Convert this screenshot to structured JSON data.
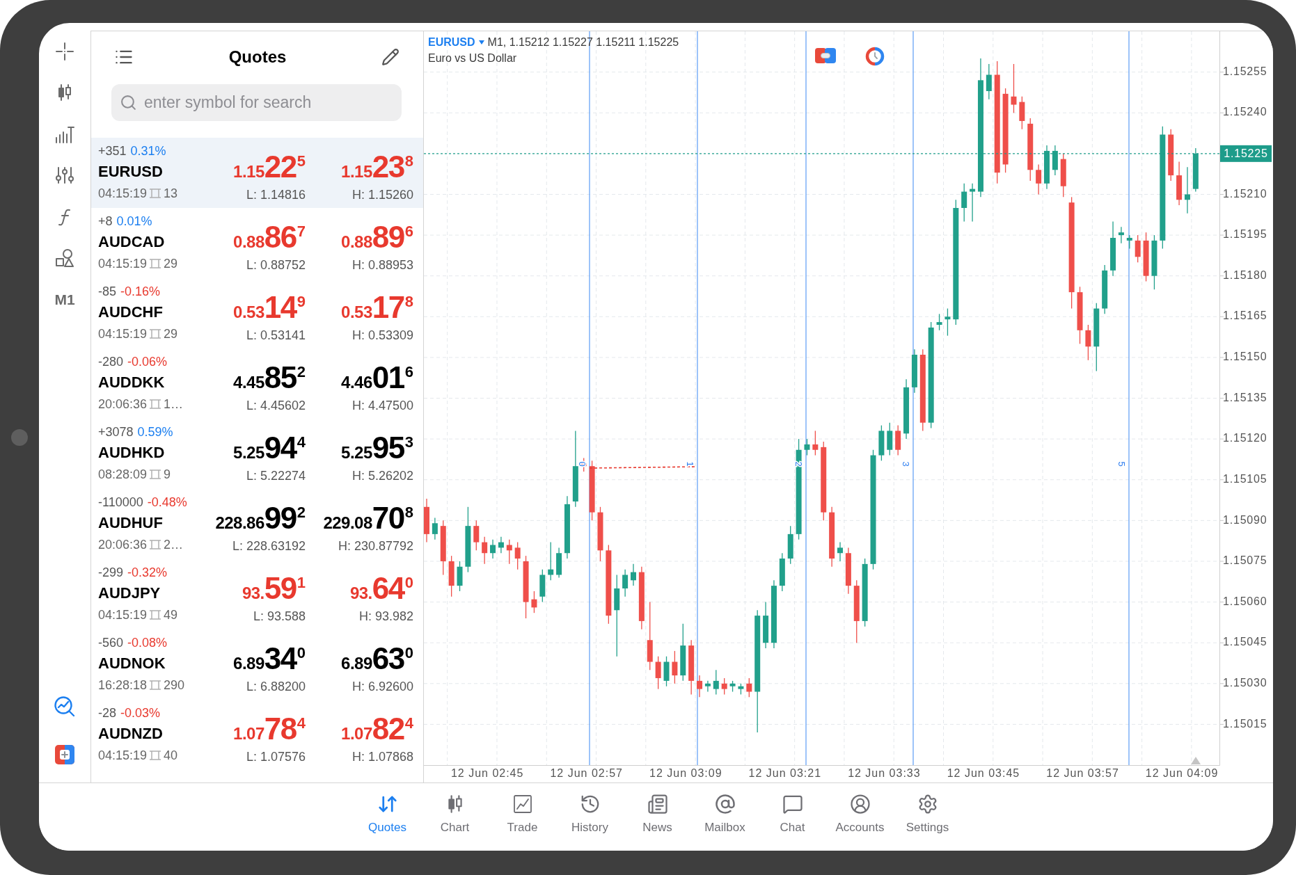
{
  "toolbar": {
    "timeframe": "M1"
  },
  "quotes_panel": {
    "title": "Quotes",
    "search": {
      "placeholder": "enter symbol for search"
    },
    "rows": [
      {
        "selected": true,
        "change": {
          "points": "+351",
          "percent": "0.31%",
          "color": "#1c7ff0"
        },
        "symbol": "EURUSD",
        "time": "04:15:19",
        "spread": "13",
        "bid": {
          "small": "1.15",
          "large": "22",
          "sup": "5",
          "color": "#e8392e"
        },
        "ask": {
          "small": "1.15",
          "large": "23",
          "sup": "8",
          "color": "#e8392e"
        },
        "low": "L: 1.14816",
        "high": "H: 1.15260"
      },
      {
        "selected": false,
        "change": {
          "points": "+8",
          "percent": "0.01%",
          "color": "#1c7ff0"
        },
        "symbol": "AUDCAD",
        "time": "04:15:19",
        "spread": "29",
        "bid": {
          "small": "0.88",
          "large": "86",
          "sup": "7",
          "color": "#e8392e"
        },
        "ask": {
          "small": "0.88",
          "large": "89",
          "sup": "6",
          "color": "#e8392e"
        },
        "low": "L: 0.88752",
        "high": "H: 0.88953"
      },
      {
        "selected": false,
        "change": {
          "points": "-85",
          "percent": "-0.16%",
          "color": "#e8392e"
        },
        "symbol": "AUDCHF",
        "time": "04:15:19",
        "spread": "29",
        "bid": {
          "small": "0.53",
          "large": "14",
          "sup": "9",
          "color": "#e8392e"
        },
        "ask": {
          "small": "0.53",
          "large": "17",
          "sup": "8",
          "color": "#e8392e"
        },
        "low": "L: 0.53141",
        "high": "H: 0.53309"
      },
      {
        "selected": false,
        "change": {
          "points": "-280",
          "percent": "-0.06%",
          "color": "#e8392e"
        },
        "symbol": "AUDDKK",
        "time": "20:06:36",
        "spread": "1…",
        "bid": {
          "small": "4.45",
          "large": "85",
          "sup": "2",
          "color": "#000000"
        },
        "ask": {
          "small": "4.46",
          "large": "01",
          "sup": "6",
          "color": "#000000"
        },
        "low": "L: 4.45602",
        "high": "H: 4.47500"
      },
      {
        "selected": false,
        "change": {
          "points": "+3078",
          "percent": "0.59%",
          "color": "#1c7ff0"
        },
        "symbol": "AUDHKD",
        "time": "08:28:09",
        "spread": "9",
        "bid": {
          "small": "5.25",
          "large": "94",
          "sup": "4",
          "color": "#000000"
        },
        "ask": {
          "small": "5.25",
          "large": "95",
          "sup": "3",
          "color": "#000000"
        },
        "low": "L: 5.22274",
        "high": "H: 5.26202"
      },
      {
        "selected": false,
        "change": {
          "points": "-110000",
          "percent": "-0.48%",
          "color": "#e8392e"
        },
        "symbol": "AUDHUF",
        "time": "20:06:36",
        "spread": "2…",
        "bid": {
          "small": "228.86",
          "large": "99",
          "sup": "2",
          "color": "#000000"
        },
        "ask": {
          "small": "229.08",
          "large": "70",
          "sup": "8",
          "color": "#000000"
        },
        "low": "L: 228.63192",
        "high": "H: 230.87792"
      },
      {
        "selected": false,
        "change": {
          "points": "-299",
          "percent": "-0.32%",
          "color": "#e8392e"
        },
        "symbol": "AUDJPY",
        "time": "04:15:19",
        "spread": "49",
        "bid": {
          "small": "93.",
          "large": "59",
          "sup": "1",
          "color": "#e8392e"
        },
        "ask": {
          "small": "93.",
          "large": "64",
          "sup": "0",
          "color": "#e8392e"
        },
        "low": "L: 93.588",
        "high": "H: 93.982"
      },
      {
        "selected": false,
        "change": {
          "points": "-560",
          "percent": "-0.08%",
          "color": "#e8392e"
        },
        "symbol": "AUDNOK",
        "time": "16:28:18",
        "spread": "290",
        "bid": {
          "small": "6.89",
          "large": "34",
          "sup": "0",
          "color": "#000000"
        },
        "ask": {
          "small": "6.89",
          "large": "63",
          "sup": "0",
          "color": "#000000"
        },
        "low": "L: 6.88200",
        "high": "H: 6.92600"
      },
      {
        "selected": false,
        "change": {
          "points": "-28",
          "percent": "-0.03%",
          "color": "#e8392e"
        },
        "symbol": "AUDNZD",
        "time": "04:15:19",
        "spread": "40",
        "bid": {
          "small": "1.07",
          "large": "78",
          "sup": "4",
          "color": "#e8392e"
        },
        "ask": {
          "small": "1.07",
          "large": "82",
          "sup": "4",
          "color": "#e8392e"
        },
        "low": "L: 1.07576",
        "high": "H: 1.07868"
      }
    ]
  },
  "chart": {
    "symbol": "EURUSD",
    "info": "M1, 1.15212 1.15227 1.15211 1.15225",
    "description": "Euro vs US Dollar",
    "marker_labels": [
      "0",
      "1",
      "2",
      "3",
      "5"
    ],
    "chart_data": {
      "type": "candlestick",
      "grid": true,
      "categories": [
        null,
        null,
        null,
        null,
        null,
        null,
        null,
        "12 Jun 02:45",
        null,
        null,
        null,
        null,
        null,
        null,
        null,
        null,
        null,
        null,
        null,
        "12 Jun 02:57",
        null,
        null,
        null,
        null,
        null,
        null,
        null,
        null,
        null,
        null,
        null,
        "12 Jun 03:09",
        null,
        null,
        null,
        null,
        null,
        null,
        null,
        null,
        null,
        null,
        null,
        "12 Jun 03:21",
        null,
        null,
        null,
        null,
        null,
        null,
        null,
        null,
        null,
        null,
        null,
        "12 Jun 03:33",
        null,
        null,
        null,
        null,
        null,
        null,
        null,
        null,
        null,
        null,
        null,
        "12 Jun 03:45",
        null,
        null,
        null,
        null,
        null,
        null,
        null,
        null,
        null,
        null,
        null,
        "12 Jun 03:57",
        null,
        null,
        null,
        null,
        null,
        null,
        null,
        null,
        null,
        null,
        null,
        "12 Jun 04:09",
        null,
        null
      ],
      "ohlc": [
        [
          1.15095,
          1.15098,
          1.15082,
          1.15085
        ],
        [
          1.15085,
          1.15091,
          1.15083,
          1.15089
        ],
        [
          1.15088,
          1.1509,
          1.1507,
          1.15075
        ],
        [
          1.15075,
          1.15077,
          1.15062,
          1.15066
        ],
        [
          1.15066,
          1.15075,
          1.15064,
          1.15073
        ],
        [
          1.15073,
          1.15095,
          1.15071,
          1.15088
        ],
        [
          1.15088,
          1.1509,
          1.15079,
          1.15082
        ],
        [
          1.15082,
          1.15084,
          1.15074,
          1.15078
        ],
        [
          1.15078,
          1.15083,
          1.15076,
          1.15081
        ],
        [
          1.1508,
          1.15084,
          1.15078,
          1.15082
        ],
        [
          1.15081,
          1.15083,
          1.15074,
          1.15079
        ],
        [
          1.1508,
          1.15082,
          1.15072,
          1.15076
        ],
        [
          1.15075,
          1.15077,
          1.15054,
          1.1506
        ],
        [
          1.15061,
          1.15064,
          1.15056,
          1.15058
        ],
        [
          1.15062,
          1.15072,
          1.1506,
          1.1507
        ],
        [
          1.1507,
          1.15082,
          1.15068,
          1.15072
        ],
        [
          1.1507,
          1.1508,
          1.15069,
          1.15078
        ],
        [
          1.15078,
          1.15099,
          1.15076,
          1.15096
        ],
        [
          1.15097,
          1.15123,
          1.15095,
          1.1511
        ],
        [
          1.15111,
          1.15113,
          1.15108,
          1.1511
        ],
        [
          1.1511,
          1.15112,
          1.1509,
          1.15093
        ],
        [
          1.15093,
          1.15095,
          1.15075,
          1.15079
        ],
        [
          1.15079,
          1.15081,
          1.15052,
          1.15055
        ],
        [
          1.15057,
          1.1507,
          1.1504,
          1.15065
        ],
        [
          1.15065,
          1.15072,
          1.15062,
          1.1507
        ],
        [
          1.15068,
          1.15074,
          1.15066,
          1.15071
        ],
        [
          1.15071,
          1.15073,
          1.1505,
          1.15053
        ],
        [
          1.15046,
          1.1506,
          1.15035,
          1.15038
        ],
        [
          1.15038,
          1.1504,
          1.15028,
          1.15032
        ],
        [
          1.15031,
          1.1504,
          1.15029,
          1.15038
        ],
        [
          1.15038,
          1.15042,
          1.1503,
          1.15033
        ],
        [
          1.15033,
          1.15052,
          1.15031,
          1.15044
        ],
        [
          1.15044,
          1.15046,
          1.15026,
          1.15031
        ],
        [
          1.15031,
          1.15033,
          1.15025,
          1.15028
        ],
        [
          1.15029,
          1.15031,
          1.15027,
          1.1503
        ],
        [
          1.15028,
          1.15035,
          1.15026,
          1.15031
        ],
        [
          1.1503,
          1.15032,
          1.15026,
          1.15028
        ],
        [
          1.15029,
          1.15031,
          1.15027,
          1.1503
        ],
        [
          1.15028,
          1.1503,
          1.15026,
          1.15029
        ],
        [
          1.1503,
          1.15032,
          1.15025,
          1.15027
        ],
        [
          1.15027,
          1.15057,
          1.15012,
          1.15055
        ],
        [
          1.15045,
          1.1506,
          1.15043,
          1.15055
        ],
        [
          1.15045,
          1.15068,
          1.15043,
          1.15066
        ],
        [
          1.15066,
          1.15078,
          1.15064,
          1.15076
        ],
        [
          1.15076,
          1.15088,
          1.15074,
          1.15085
        ],
        [
          1.15085,
          1.1512,
          1.15083,
          1.15116
        ],
        [
          1.15116,
          1.1512,
          1.15114,
          1.15118
        ],
        [
          1.15118,
          1.15123,
          1.15114,
          1.15116
        ],
        [
          1.15117,
          1.15119,
          1.1509,
          1.15093
        ],
        [
          1.15093,
          1.15095,
          1.15073,
          1.15076
        ],
        [
          1.15078,
          1.15082,
          1.15075,
          1.1508
        ],
        [
          1.15078,
          1.1508,
          1.15063,
          1.15066
        ],
        [
          1.15066,
          1.15068,
          1.15045,
          1.15053
        ],
        [
          1.15053,
          1.15076,
          1.15051,
          1.15074
        ],
        [
          1.15074,
          1.15116,
          1.15072,
          1.15114
        ],
        [
          1.15114,
          1.15125,
          1.15112,
          1.15123
        ],
        [
          1.15116,
          1.15126,
          1.15114,
          1.15123
        ],
        [
          1.15123,
          1.15125,
          1.15114,
          1.15116
        ],
        [
          1.15122,
          1.15142,
          1.1512,
          1.15139
        ],
        [
          1.15139,
          1.15153,
          1.15137,
          1.15151
        ],
        [
          1.15151,
          1.15153,
          1.15123,
          1.15126
        ],
        [
          1.15126,
          1.15163,
          1.15124,
          1.15161
        ],
        [
          1.15162,
          1.15166,
          1.1516,
          1.15163
        ],
        [
          1.15164,
          1.15168,
          1.15158,
          1.15165
        ],
        [
          1.15164,
          1.15208,
          1.15162,
          1.15205
        ],
        [
          1.15205,
          1.15214,
          1.152,
          1.15211
        ],
        [
          1.15211,
          1.15214,
          1.152,
          1.15212
        ],
        [
          1.15211,
          1.1526,
          1.15209,
          1.15252
        ],
        [
          1.15248,
          1.15258,
          1.15245,
          1.15254
        ],
        [
          1.15254,
          1.15259,
          1.15214,
          1.15218
        ],
        [
          1.15247,
          1.15249,
          1.15218,
          1.15221
        ],
        [
          1.15246,
          1.15258,
          1.1524,
          1.15243
        ],
        [
          1.15244,
          1.15246,
          1.15234,
          1.15237
        ],
        [
          1.15236,
          1.15238,
          1.15215,
          1.15219
        ],
        [
          1.15219,
          1.15221,
          1.1521,
          1.15214
        ],
        [
          1.15214,
          1.15228,
          1.15212,
          1.15226
        ],
        [
          1.15219,
          1.15228,
          1.15217,
          1.15226
        ],
        [
          1.15223,
          1.15225,
          1.15209,
          1.15213
        ],
        [
          1.15207,
          1.15209,
          1.15168,
          1.15174
        ],
        [
          1.15174,
          1.15176,
          1.15155,
          1.1516
        ],
        [
          1.1516,
          1.15162,
          1.15149,
          1.15154
        ],
        [
          1.15154,
          1.1517,
          1.15145,
          1.15168
        ],
        [
          1.15168,
          1.15184,
          1.15166,
          1.15182
        ],
        [
          1.15182,
          1.152,
          1.1518,
          1.15194
        ],
        [
          1.15195,
          1.15198,
          1.15192,
          1.15196
        ],
        [
          1.15193,
          1.15195,
          1.1519,
          1.15194
        ],
        [
          1.15193,
          1.15195,
          1.15185,
          1.15187
        ],
        [
          1.15193,
          1.15196,
          1.15178,
          1.1518
        ],
        [
          1.1518,
          1.15195,
          1.15175,
          1.15193
        ],
        [
          1.15193,
          1.15235,
          1.1519,
          1.15232
        ],
        [
          1.15232,
          1.15234,
          1.15215,
          1.15217
        ],
        [
          1.15217,
          1.15222,
          1.15206,
          1.15208
        ],
        [
          1.15208,
          1.1522,
          1.15203,
          1.1521
        ],
        [
          1.15212,
          1.15227,
          1.15211,
          1.15225
        ]
      ],
      "ylim": [
        1.15,
        1.1527
      ],
      "yticks": [
        {
          "value": 1.15255,
          "label": "1.15255"
        },
        {
          "value": 1.1524,
          "label": "1.15240"
        },
        {
          "value": 1.1521,
          "label": "1.15210"
        },
        {
          "value": 1.15195,
          "label": "1.15195"
        },
        {
          "value": 1.1518,
          "label": "1.15180"
        },
        {
          "value": 1.15165,
          "label": "1.15165"
        },
        {
          "value": 1.1515,
          "label": "1.15150"
        },
        {
          "value": 1.15135,
          "label": "1.15135"
        },
        {
          "value": 1.1512,
          "label": "1.15120"
        },
        {
          "value": 1.15105,
          "label": "1.15105"
        },
        {
          "value": 1.1509,
          "label": "1.15090"
        },
        {
          "value": 1.15075,
          "label": "1.15075"
        },
        {
          "value": 1.1506,
          "label": "1.15060"
        },
        {
          "value": 1.15045,
          "label": "1.15045"
        },
        {
          "value": 1.1503,
          "label": "1.15030"
        },
        {
          "value": 1.15015,
          "label": "1.15015"
        }
      ],
      "ref_lines": [
        {
          "axis": "y",
          "value": 1.15225,
          "label": "1.15225",
          "color": "#1d9c8a"
        }
      ]
    }
  },
  "tabs": [
    {
      "label": "Quotes",
      "selected": true
    },
    {
      "label": "Chart",
      "selected": false
    },
    {
      "label": "Trade",
      "selected": false
    },
    {
      "label": "History",
      "selected": false
    },
    {
      "label": "News",
      "selected": false
    },
    {
      "label": "Mailbox",
      "selected": false
    },
    {
      "label": "Chat",
      "selected": false
    },
    {
      "label": "Accounts",
      "selected": false
    },
    {
      "label": "Settings",
      "selected": false
    }
  ]
}
